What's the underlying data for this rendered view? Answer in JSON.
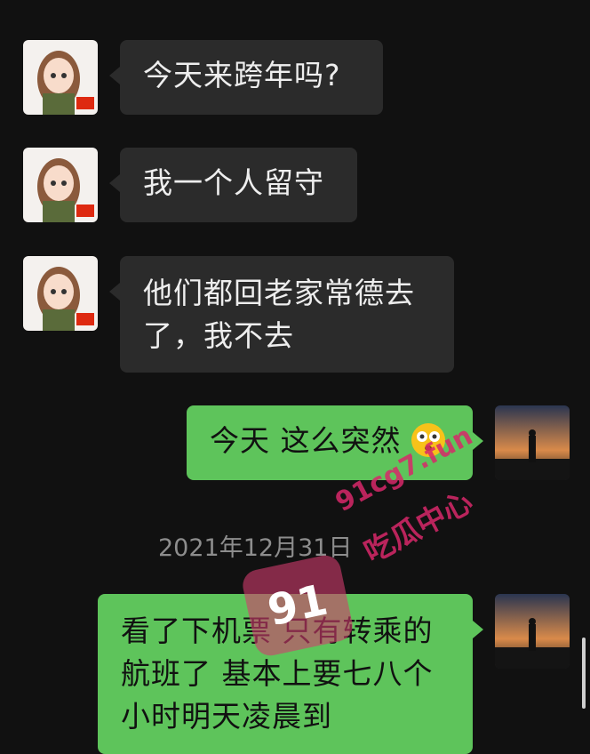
{
  "messages": [
    {
      "side": "in",
      "text": "今天来跨年吗?"
    },
    {
      "side": "in",
      "text": "我一个人留守"
    },
    {
      "side": "in",
      "text_line1": "他们都回老家常德去",
      "text_line2": "了，我不去"
    },
    {
      "side": "out",
      "text": "今天 这么突然",
      "emoji": "flushed-face"
    },
    {
      "side": "out",
      "text_line1": "看了下机票 只有转乘的",
      "text_line2": "航班了 基本上要七八个",
      "text_line3": "小时明天凌晨到"
    }
  ],
  "timestamp": "2021年12月31日",
  "watermark": {
    "site": "91cg7.fun",
    "name": "吃瓜中心",
    "logo": "91"
  },
  "colors": {
    "background": "#111111",
    "incoming": "#2b2b2b",
    "outgoing": "#5ec45b",
    "watermark": "#d8286a"
  }
}
